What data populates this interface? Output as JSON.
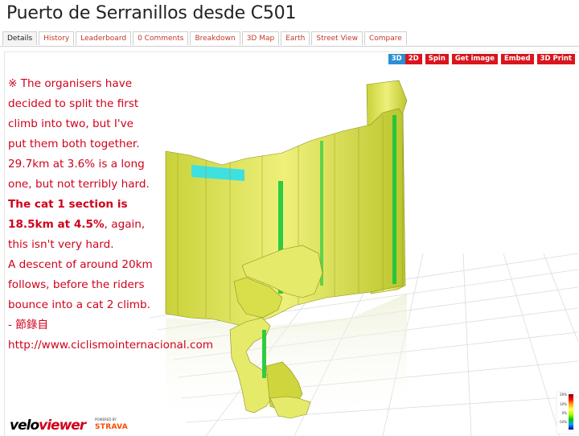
{
  "page": {
    "title": "Puerto de Serranillos desde C501"
  },
  "tabs": [
    {
      "label": "Details",
      "active": true
    },
    {
      "label": "History"
    },
    {
      "label": "Leaderboard"
    },
    {
      "label": "0 Comments"
    },
    {
      "label": "Breakdown"
    },
    {
      "label": "3D Map"
    },
    {
      "label": "Earth"
    },
    {
      "label": "Street View"
    },
    {
      "label": "Compare"
    }
  ],
  "toolbar": {
    "btn_3d": "3D",
    "btn_2d": "2D",
    "btn_spin": "Spin",
    "btn_get_image": "Get image",
    "btn_embed": "Embed",
    "btn_3d_print": "3D Print"
  },
  "description": {
    "line1": "※ The organisers have",
    "line2": "decided to split the first",
    "line3": "climb into two, but I've",
    "line4": "put them both together.",
    "line5": "29.7km at 3.6% is a long",
    "line6": "one, but not terribly hard.",
    "line7": "The cat 1 section is",
    "line8_bold": "18.5km at 4.5%",
    "line8_rest": ", again,",
    "line9": "this isn't very hard.",
    "line10": "A descent of around 20km",
    "line11": "follows, before the riders",
    "line12": "bounce into a cat 2 climb.",
    "line13": "- 節錄自",
    "link": "http://www.ciclismointernacional.com"
  },
  "branding": {
    "velo": "velo",
    "viewer": "viewer",
    "powered": "POWERED BY",
    "strava": "STRAVA"
  },
  "scale": {
    "top": "20%",
    "mid": "10%",
    "zero": "0%",
    "low": "-10%"
  },
  "colors": {
    "accent": "#d9151d",
    "selected": "#2a8fd6",
    "link": "#d0021b"
  }
}
